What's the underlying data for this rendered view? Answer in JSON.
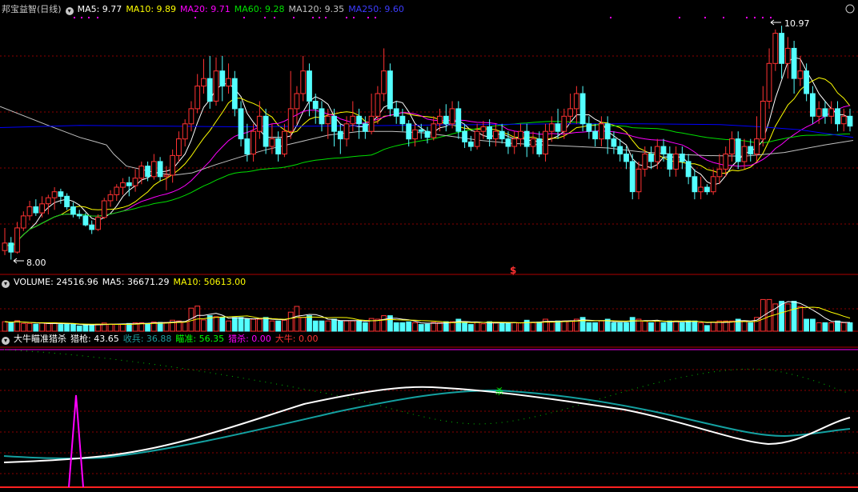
{
  "header_price": {
    "stock": "邦宝益智(日线)",
    "ma5": "MA5: 9.77",
    "ma10": "MA10: 9.89",
    "ma20": "MA20: 9.71",
    "ma60": "MA60: 9.28",
    "ma120": "MA120: 9.35",
    "ma250": "MA250: 9.60"
  },
  "header_volume": {
    "volume": "VOLUME: 24516.96",
    "ma5": "MA5: 36671.29",
    "ma10": "MA10: 50613.00"
  },
  "header_indicator": {
    "name": "大牛瞄准猎杀",
    "lieqiang": "猎枪: 43.65",
    "shoubing": "收兵: 36.88",
    "miaozhun": "瞄准: 56.35",
    "liesha": "猎杀: 0.00",
    "daniu": "大牛: 0.00"
  },
  "annotations": {
    "high": "10.97",
    "low": "8.00",
    "signal": "$",
    "kill": "杀"
  },
  "colors": {
    "up": "#ff3232",
    "down": "#54ffff",
    "ma5": "#ffffff",
    "ma10": "#ffff00",
    "ma20": "#ff00ff",
    "ma60": "#00e000",
    "ma120": "#c0c0c0",
    "ma250": "#0000ff",
    "grid": "#8b0000",
    "panel_border": "#b00000",
    "kill": "#00ff00"
  },
  "chart_data": [
    {
      "type": "candlestick",
      "title": "邦宝益智(日线)",
      "ylim": [
        7.9,
        11.25
      ],
      "series": [
        {
          "name": "MA5",
          "value": 9.77
        },
        {
          "name": "MA10",
          "value": 9.89
        },
        {
          "name": "MA20",
          "value": 9.71
        },
        {
          "name": "MA60",
          "value": 9.28
        },
        {
          "name": "MA120",
          "value": 9.35
        },
        {
          "name": "MA250",
          "value": 9.6
        }
      ],
      "candles": [
        [
          8.12,
          8.22,
          8.42,
          8.06
        ],
        [
          8.22,
          8.1,
          8.3,
          8.0
        ],
        [
          8.1,
          8.42,
          8.5,
          8.08
        ],
        [
          8.42,
          8.58,
          8.64,
          8.38
        ],
        [
          8.58,
          8.7,
          8.78,
          8.52
        ],
        [
          8.7,
          8.62,
          8.8,
          8.58
        ],
        [
          8.62,
          8.74,
          8.84,
          8.56
        ],
        [
          8.74,
          8.82,
          8.86,
          8.6
        ],
        [
          8.82,
          8.9,
          8.96,
          8.66
        ],
        [
          8.9,
          8.84,
          8.94,
          8.74
        ],
        [
          8.84,
          8.7,
          8.88,
          8.66
        ],
        [
          8.7,
          8.6,
          8.76,
          8.56
        ],
        [
          8.6,
          8.58,
          8.66,
          8.54
        ],
        [
          8.58,
          8.46,
          8.62,
          8.44
        ],
        [
          8.46,
          8.4,
          8.52,
          8.34
        ],
        [
          8.4,
          8.56,
          8.6,
          8.38
        ],
        [
          8.56,
          8.78,
          8.82,
          8.54
        ],
        [
          8.78,
          8.86,
          8.92,
          8.7
        ],
        [
          8.86,
          8.96,
          9.0,
          8.78
        ],
        [
          8.96,
          9.02,
          9.08,
          8.86
        ],
        [
          9.02,
          8.98,
          9.1,
          8.84
        ],
        [
          8.98,
          9.08,
          9.2,
          8.9
        ],
        [
          9.08,
          9.24,
          9.3,
          9.0
        ],
        [
          9.24,
          9.1,
          9.3,
          9.04
        ],
        [
          9.1,
          9.3,
          9.4,
          9.06
        ],
        [
          9.3,
          9.1,
          9.36,
          9.04
        ],
        [
          9.1,
          9.12,
          9.24,
          8.92
        ],
        [
          9.12,
          9.38,
          9.46,
          9.02
        ],
        [
          9.38,
          9.6,
          9.7,
          9.3
        ],
        [
          9.6,
          9.8,
          9.86,
          9.5
        ],
        [
          9.8,
          10.0,
          10.1,
          9.7
        ],
        [
          10.0,
          10.3,
          10.46,
          9.94
        ],
        [
          10.3,
          10.4,
          10.66,
          10.2
        ],
        [
          10.4,
          10.1,
          10.7,
          10.0
        ],
        [
          10.1,
          10.5,
          10.68,
          10.04
        ],
        [
          10.5,
          10.3,
          10.7,
          10.1
        ],
        [
          10.3,
          10.4,
          10.6,
          10.2
        ],
        [
          10.4,
          10.0,
          10.5,
          9.9
        ],
        [
          10.0,
          9.6,
          10.1,
          9.5
        ],
        [
          9.6,
          9.4,
          9.8,
          9.3
        ],
        [
          9.4,
          9.7,
          9.8,
          9.3
        ],
        [
          9.7,
          9.9,
          10.1,
          9.6
        ],
        [
          9.9,
          9.5,
          10.0,
          9.4
        ],
        [
          9.5,
          9.6,
          9.8,
          9.4
        ],
        [
          9.6,
          9.4,
          9.7,
          9.3
        ],
        [
          9.4,
          9.7,
          9.8,
          9.36
        ],
        [
          9.7,
          10.0,
          10.5,
          9.6
        ],
        [
          10.0,
          10.2,
          10.3,
          9.8
        ],
        [
          10.2,
          10.5,
          10.7,
          10.1
        ],
        [
          10.5,
          10.1,
          10.6,
          9.9
        ],
        [
          10.1,
          10.0,
          10.2,
          9.8
        ],
        [
          10.0,
          9.8,
          10.1,
          9.7
        ],
        [
          9.8,
          9.9,
          10.0,
          9.6
        ],
        [
          9.9,
          9.7,
          10.0,
          9.5
        ],
        [
          9.7,
          9.6,
          9.8,
          9.4
        ],
        [
          9.6,
          9.8,
          9.9,
          9.5
        ],
        [
          9.8,
          9.9,
          10.1,
          9.7
        ],
        [
          9.9,
          9.8,
          10.0,
          9.6
        ],
        [
          9.8,
          9.7,
          9.9,
          9.6
        ],
        [
          9.7,
          9.9,
          10.2,
          9.66
        ],
        [
          9.9,
          10.2,
          10.3,
          9.8
        ],
        [
          10.2,
          10.5,
          10.8,
          10.1
        ],
        [
          10.5,
          10.0,
          10.6,
          9.9
        ],
        [
          10.0,
          9.9,
          10.1,
          9.8
        ],
        [
          9.9,
          9.8,
          10.0,
          9.7
        ],
        [
          9.8,
          9.6,
          9.85,
          9.5
        ],
        [
          9.6,
          9.72,
          9.8,
          9.5
        ],
        [
          9.72,
          9.7,
          9.8,
          9.6
        ],
        [
          9.7,
          9.62,
          9.76,
          9.54
        ],
        [
          9.62,
          9.8,
          9.9,
          9.58
        ],
        [
          9.8,
          9.9,
          10.0,
          9.7
        ],
        [
          9.9,
          9.8,
          10.06,
          9.7
        ],
        [
          9.8,
          10.0,
          10.1,
          9.74
        ],
        [
          10.0,
          9.7,
          10.1,
          9.6
        ],
        [
          9.7,
          9.56,
          9.8,
          9.48
        ],
        [
          9.56,
          9.5,
          9.64,
          9.44
        ],
        [
          9.5,
          9.7,
          9.8,
          9.46
        ],
        [
          9.7,
          9.76,
          9.84,
          9.6
        ],
        [
          9.76,
          9.6,
          9.86,
          9.5
        ],
        [
          9.6,
          9.7,
          9.8,
          9.5
        ],
        [
          9.7,
          9.6,
          9.8,
          9.54
        ],
        [
          9.6,
          9.5,
          9.7,
          9.4
        ],
        [
          9.5,
          9.6,
          9.7,
          9.4
        ],
        [
          9.6,
          9.7,
          9.8,
          9.5
        ],
        [
          9.7,
          9.5,
          9.8,
          9.36
        ],
        [
          9.5,
          9.6,
          9.7,
          9.4
        ],
        [
          9.6,
          9.4,
          9.7,
          9.36
        ],
        [
          9.4,
          9.7,
          9.8,
          9.3
        ],
        [
          9.7,
          9.8,
          9.9,
          9.56
        ],
        [
          9.8,
          9.7,
          10.0,
          9.6
        ],
        [
          9.7,
          9.9,
          10.0,
          9.6
        ],
        [
          9.9,
          10.0,
          10.2,
          9.8
        ],
        [
          10.0,
          10.2,
          10.3,
          9.8
        ],
        [
          10.2,
          9.8,
          10.3,
          9.7
        ],
        [
          9.8,
          9.7,
          9.9,
          9.6
        ],
        [
          9.7,
          9.6,
          9.8,
          9.5
        ],
        [
          9.6,
          9.8,
          9.9,
          9.5
        ],
        [
          9.8,
          9.6,
          9.9,
          9.4
        ],
        [
          9.6,
          9.5,
          9.7,
          9.4
        ],
        [
          9.5,
          9.4,
          9.6,
          9.3
        ],
        [
          9.4,
          9.3,
          9.5,
          9.2
        ],
        [
          9.3,
          8.9,
          9.4,
          8.8
        ],
        [
          8.9,
          9.2,
          9.3,
          8.8
        ],
        [
          9.2,
          9.4,
          9.5,
          9.1
        ],
        [
          9.4,
          9.3,
          9.5,
          9.2
        ],
        [
          9.3,
          9.5,
          9.6,
          9.2
        ],
        [
          9.5,
          9.4,
          9.6,
          9.3
        ],
        [
          9.4,
          9.2,
          9.5,
          9.1
        ],
        [
          9.2,
          9.4,
          9.5,
          9.1
        ],
        [
          9.4,
          9.3,
          9.5,
          9.2
        ],
        [
          9.3,
          9.1,
          9.4,
          9.0
        ],
        [
          9.1,
          8.9,
          9.2,
          8.8
        ],
        [
          8.9,
          8.96,
          9.1,
          8.8
        ],
        [
          8.96,
          8.9,
          9.0,
          8.86
        ],
        [
          8.9,
          9.1,
          9.2,
          8.86
        ],
        [
          9.1,
          9.2,
          9.4,
          9.0
        ],
        [
          9.2,
          9.4,
          9.5,
          9.1
        ],
        [
          9.4,
          9.6,
          9.7,
          9.3
        ],
        [
          9.6,
          9.3,
          9.7,
          9.2
        ],
        [
          9.3,
          9.5,
          9.6,
          9.2
        ],
        [
          9.5,
          9.4,
          9.6,
          9.3
        ],
        [
          9.4,
          9.6,
          9.9,
          9.3
        ],
        [
          9.6,
          10.1,
          10.3,
          9.5
        ],
        [
          10.1,
          10.6,
          10.8,
          10.0
        ],
        [
          10.6,
          11.0,
          11.05,
          10.5
        ],
        [
          11.0,
          10.6,
          11.1,
          10.4
        ],
        [
          10.6,
          10.8,
          10.95,
          10.4
        ],
        [
          10.8,
          10.4,
          10.9,
          10.2
        ],
        [
          10.4,
          10.5,
          10.7,
          10.3
        ],
        [
          10.5,
          10.2,
          10.6,
          10.1
        ],
        [
          10.2,
          9.9,
          10.3,
          9.8
        ],
        [
          9.9,
          10.0,
          10.1,
          9.8
        ],
        [
          10.0,
          9.9,
          10.1,
          9.8
        ],
        [
          9.9,
          10.0,
          10.1,
          9.8
        ],
        [
          10.0,
          9.8,
          10.1,
          9.7
        ],
        [
          9.8,
          9.9,
          10.0,
          9.7
        ],
        [
          9.9,
          9.77,
          10.0,
          9.7
        ]
      ]
    },
    {
      "type": "bar",
      "title": "VOLUME",
      "series": [
        {
          "name": "VOLUME",
          "value": 24516.96
        },
        {
          "name": "MA5",
          "value": 36671.29
        },
        {
          "name": "MA10",
          "value": 50613.0
        }
      ]
    },
    {
      "type": "line",
      "title": "大牛瞄准猎杀",
      "series": [
        {
          "name": "猎枪",
          "value": 43.65
        },
        {
          "name": "收兵",
          "value": 36.88
        },
        {
          "name": "瞄准",
          "value": 56.35
        },
        {
          "name": "猎杀",
          "value": 0.0
        },
        {
          "name": "大牛",
          "value": 0.0
        }
      ]
    }
  ]
}
